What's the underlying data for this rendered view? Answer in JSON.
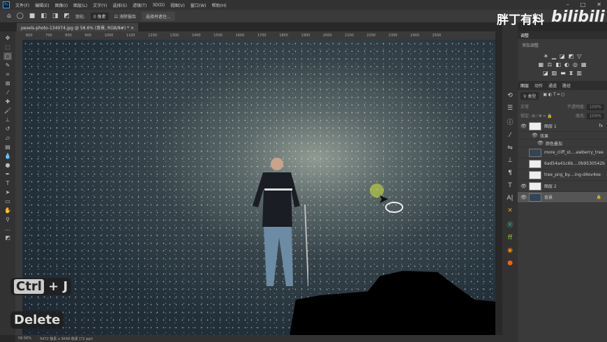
{
  "menu": {
    "logo": "Ps",
    "items": [
      "文件(F)",
      "编辑(E)",
      "图像(I)",
      "图层(L)",
      "文字(Y)",
      "选择(S)",
      "滤镜(T)",
      "3D(D)",
      "视图(V)",
      "窗口(W)",
      "帮助(H)"
    ]
  },
  "options": {
    "feather_label": "羽化:",
    "feather_value": "0 像素",
    "antialias_label": "消除锯齿",
    "select_mask": "选择并遮住..."
  },
  "document_tab": "pexels-photo-134074.jpg @ 58.6% (背景, RGB/8#) *",
  "ruler": [
    "600",
    "700",
    "800",
    "900",
    "1000",
    "1100",
    "1200",
    "1300",
    "1400",
    "1500",
    "1600",
    "1700",
    "1800",
    "1900",
    "2000",
    "2100",
    "2200",
    "2300",
    "2400",
    "2500"
  ],
  "overlay": {
    "brand": "胖丁有料",
    "bilibili": "bilibili",
    "key1": "Ctrl",
    "plus_j": "+ J",
    "key2": "Delete"
  },
  "status": {
    "zoom": "58.56%",
    "size": "5472 像素 x 3648 像素 (72 ppi)"
  },
  "adjustments": {
    "tab": "调整",
    "title": "添加调整"
  },
  "layers_panel": {
    "tabs": [
      "图层",
      "动作",
      "通道",
      "路径"
    ],
    "filter": "类型",
    "blend": "正常",
    "opacity_label": "不透明度:",
    "opacity": "100%",
    "lock_label": "锁定:",
    "fill_label": "填充:",
    "fill": "100%",
    "layers": [
      {
        "name": "图层 1",
        "visible": true,
        "fx": "fx"
      },
      {
        "name": "效果",
        "visible": true,
        "sub": true
      },
      {
        "name": "颜色叠加",
        "visible": true,
        "sub": true
      },
      {
        "name": "more_cliff_st....awberry_tree",
        "visible": false
      },
      {
        "name": "6ad54a41c6b....0b9530542b",
        "visible": false
      },
      {
        "name": "tree_png_by....ing-d4ov4oe",
        "visible": false
      },
      {
        "name": "图层 2",
        "visible": true
      },
      {
        "name": "背景",
        "visible": true,
        "selected": true
      }
    ]
  }
}
